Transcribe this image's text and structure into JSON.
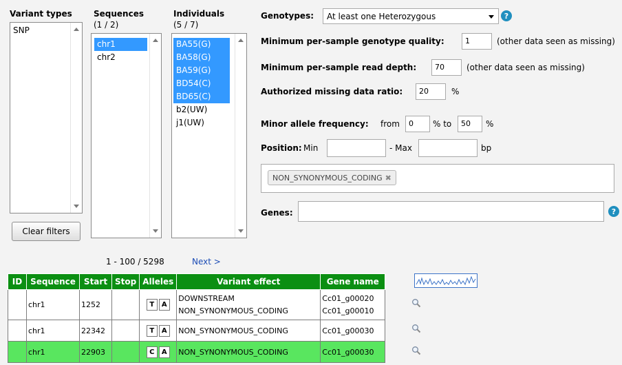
{
  "filters": {
    "variant_types": {
      "title": "Variant types",
      "items": [
        "SNP"
      ]
    },
    "sequences": {
      "title": "Sequences",
      "count": "(1 / 2)",
      "items": [
        {
          "label": "chr1",
          "selected": true
        },
        {
          "label": "chr2",
          "selected": false
        }
      ]
    },
    "individuals": {
      "title": "Individuals",
      "count": "(5 / 7)",
      "items": [
        {
          "label": "BA55(G)",
          "selected": true
        },
        {
          "label": "BA58(G)",
          "selected": true
        },
        {
          "label": "BA59(G)",
          "selected": true
        },
        {
          "label": "BD54(C)",
          "selected": true
        },
        {
          "label": "BD65(C)",
          "selected": true
        },
        {
          "label": "b2(UW)",
          "selected": false
        },
        {
          "label": "j1(UW)",
          "selected": false
        }
      ]
    },
    "clear_label": "Clear filters"
  },
  "form": {
    "genotypes_label": "Genotypes:",
    "genotypes_value": "At least one Heterozygous",
    "gq_label": "Minimum per-sample genotype quality:",
    "gq_value": "1",
    "gq_note": "(other data seen as missing)",
    "depth_label": "Minimum per-sample read depth:",
    "depth_value": "70",
    "depth_note": "(other data seen as missing)",
    "missing_label": "Authorized missing data ratio:",
    "missing_value": "20",
    "missing_unit": "%",
    "maf_label": "Minor allele frequency:",
    "maf_from": "from",
    "maf_from_value": "0",
    "maf_to": "% to",
    "maf_to_value": "50",
    "maf_unit": "%",
    "pos_label": "Position:",
    "pos_min": "Min",
    "pos_min_value": "",
    "pos_max": "- Max",
    "pos_max_value": "",
    "pos_unit": "bp",
    "effect_tag": "NON_SYNONYMOUS_CODING",
    "genes_label": "Genes:",
    "genes_value": "",
    "help_glyph": "?"
  },
  "pager": {
    "range": "1 - 100 / 5298",
    "next": "Next >"
  },
  "table": {
    "headers": [
      "ID",
      "Sequence",
      "Start",
      "Stop",
      "Alleles",
      "Variant effect",
      "Gene name"
    ],
    "rows": [
      {
        "id": "",
        "sequence": "chr1",
        "start": "1252",
        "stop": "",
        "ref": "T",
        "alt": "A",
        "effect1": "DOWNSTREAM",
        "effect2": "NON_SYNONYMOUS_CODING",
        "gene1": "Cc01_g00020",
        "gene2": "Cc01_g00010",
        "highlight": false
      },
      {
        "id": "",
        "sequence": "chr1",
        "start": "22342",
        "stop": "",
        "ref": "T",
        "alt": "A",
        "effect1": "NON_SYNONYMOUS_CODING",
        "effect2": "",
        "gene1": "Cc01_g00030",
        "gene2": "",
        "highlight": false
      },
      {
        "id": "",
        "sequence": "chr1",
        "start": "22903",
        "stop": "",
        "ref": "C",
        "alt": "A",
        "effect1": "NON_SYNONYMOUS_CODING",
        "effect2": "",
        "gene1": "Cc01_g00030",
        "gene2": "",
        "highlight": true
      }
    ]
  },
  "colors": {
    "header_green": "#0b8f12",
    "highlight_green": "#59e65f",
    "selection_blue": "#3399ff",
    "help_blue": "#1f8fbf"
  },
  "icons": {
    "sparkline": "sparkline-chart-icon",
    "magnifier": "magnifier-icon",
    "close": "close-icon"
  }
}
